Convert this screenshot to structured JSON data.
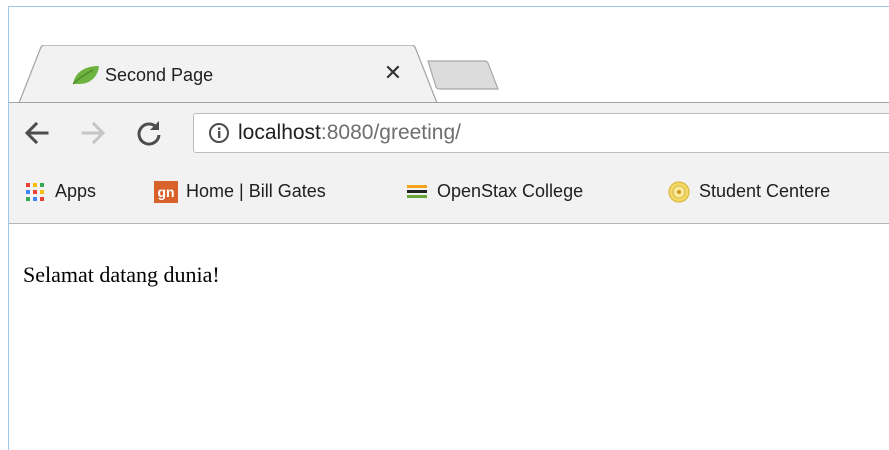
{
  "tab": {
    "title": "Second Page",
    "close_symbol": "✕",
    "favicon": "spring-leaf-icon"
  },
  "toolbar": {
    "back_icon": "arrow-left-icon",
    "forward_icon": "arrow-right-icon",
    "reload_icon": "reload-icon",
    "info_icon": "info-icon",
    "url_host": "localhost",
    "url_rest": ":8080/greeting/"
  },
  "bookmarks": {
    "items": [
      {
        "label": "Apps",
        "icon": "apps-grid-icon"
      },
      {
        "label": "Home | Bill Gates",
        "icon": "gn-logo-icon"
      },
      {
        "label": "OpenStax College",
        "icon": "openstax-stack-icon"
      },
      {
        "label": "Student Centere",
        "icon": "seal-icon"
      }
    ]
  },
  "page": {
    "greeting": "Selamat datang dunia!"
  },
  "colors": {
    "window_border": "#9fc7e8",
    "toolbar_bg": "#f2f2f2",
    "favicon_green": "#6db33f",
    "gn_orange": "#d9622b"
  }
}
